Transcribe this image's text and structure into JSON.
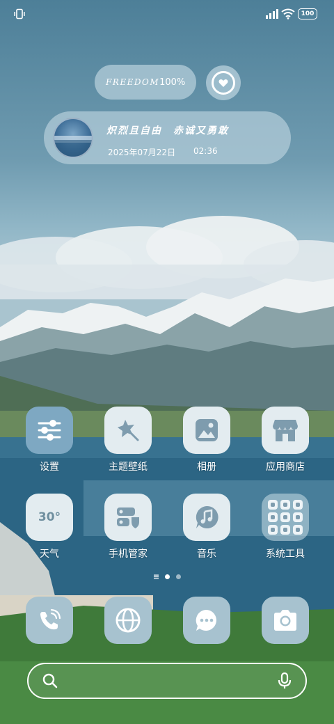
{
  "status_bar": {
    "battery_level": "100",
    "icons": [
      "vibrate-icon",
      "signal-icon",
      "wifi-icon",
      "battery-icon"
    ]
  },
  "widget": {
    "freedom_label": "FREEDOM",
    "percent": "100%",
    "heart_icon": "heart-icon"
  },
  "music": {
    "title": "炽烈且自由　赤诚又勇敢",
    "date": "2025年07月22日",
    "time": "02:36"
  },
  "apps": [
    {
      "label": "设置",
      "icon": "settings-icon"
    },
    {
      "label": "主题壁纸",
      "icon": "theme-icon"
    },
    {
      "label": "相册",
      "icon": "gallery-icon"
    },
    {
      "label": "应用商店",
      "icon": "store-icon"
    },
    {
      "label": "天气",
      "icon": "weather-icon",
      "value": "30°"
    },
    {
      "label": "手机管家",
      "icon": "security-icon"
    },
    {
      "label": "音乐",
      "icon": "music-icon"
    },
    {
      "label": "系统工具",
      "icon": "folder-icon"
    }
  ],
  "page_indicator": {
    "pages": 2,
    "current": 1
  },
  "dock": [
    "phone-icon",
    "browser-icon",
    "messages-icon",
    "camera-icon"
  ],
  "colors": {
    "icon_bg": "#e3ecf0",
    "icon_glyph": "#7e9cae",
    "accent_blue": "#7ea8c2"
  }
}
